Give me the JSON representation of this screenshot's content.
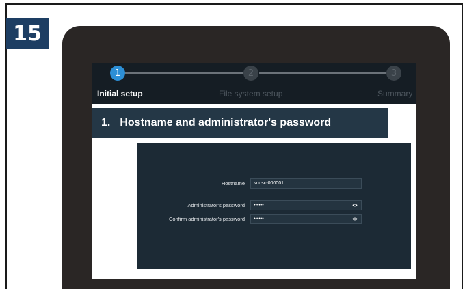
{
  "badge": {
    "step_number": "15"
  },
  "stepper": {
    "steps": [
      {
        "number": "1",
        "label": "Initial setup",
        "active": true
      },
      {
        "number": "2",
        "label": "File system setup",
        "active": false
      },
      {
        "number": "3",
        "label": "Summary",
        "active": false
      }
    ]
  },
  "section": {
    "number": "1.",
    "title": "Hostname and administrator's password"
  },
  "form": {
    "hostname_label": "Hostname",
    "hostname_value": "snosc-000001",
    "admin_password_label": "Administrator's password",
    "admin_password_value": "••••••",
    "confirm_password_label": "Confirm administrator's password",
    "confirm_password_value": "••••••"
  },
  "colors": {
    "badge_bg": "#1d3e63",
    "device_frame": "#2a2625",
    "stepper_bg": "#151d24",
    "active_step": "#2d8fd6",
    "section_bg": "#243746",
    "form_bg": "#1c2a35"
  }
}
